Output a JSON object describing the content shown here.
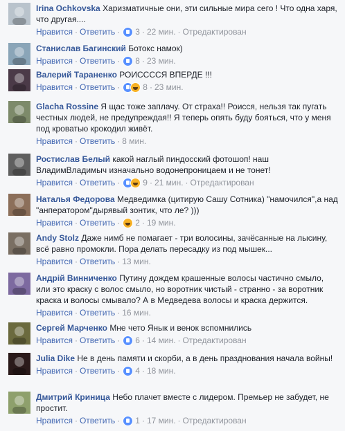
{
  "ui": {
    "like": "Нравится",
    "reply": "Ответить",
    "edited": "Отредактирован",
    "dot": "·"
  },
  "comments": [
    {
      "name": "Irina Ochkovska",
      "text": "Харизматичные они, эти сильные мира сего ! Что одна харя, что другая....",
      "reactions": [
        "like"
      ],
      "count": "3",
      "time": "22 мин.",
      "edited": true,
      "avatar": "#b9c3cc"
    },
    {
      "name": "Станислав Багинский",
      "text": "Ботокс намок)",
      "reactions": [
        "like"
      ],
      "count": "8",
      "time": "23 мин.",
      "edited": false,
      "avatar": "#8aa5b8"
    },
    {
      "name": "Валерий Тараненко",
      "text": "РОИСССCЯ ВПЕРДЕ !!!",
      "reactions": [
        "like",
        "haha"
      ],
      "count": "8",
      "time": "23 мин.",
      "edited": false,
      "avatar": "#4b3a48"
    },
    {
      "name": "Glacha Rossine",
      "text": "Я щас тоже заплачу. От страха!! Роисся, нельзя так пугать честных людей, не предупреждая!! Я теперь опять буду бояться, что у меня под кроватью крокодил живёт.",
      "reactions": [],
      "count": "",
      "time": "8 мин.",
      "edited": false,
      "avatar": "#7d8a6a"
    },
    {
      "name": "Ростислав Белый",
      "text": "какой наглый пиндосский фотошоп! наш ВладимВладимыч изначально водонепроницаем и не тонет!",
      "reactions": [
        "like",
        "haha"
      ],
      "count": "9",
      "time": "21 мин.",
      "edited": true,
      "avatar": "#5f5f5f"
    },
    {
      "name": "Наталья Федорова",
      "text": "Медведимка (цитирую Сашу Сотника) \"намочился\",а над \"анператором\"дырявый зонтик, что ле? )))",
      "reactions": [
        "haha"
      ],
      "count": "2",
      "time": "19 мин.",
      "edited": false,
      "avatar": "#8c6f5a"
    },
    {
      "name": "Andy Stolz",
      "text": "Даже нимб не помагает - три волосины, зачёсанные на лысину, всё равно промокли. Пора делать пересадку из под мышек...",
      "reactions": [],
      "count": "",
      "time": "13 мин.",
      "edited": false,
      "avatar": "#7a6f63"
    },
    {
      "name": "Андрій Винниченко",
      "text": "Путину дождем крашенные волосы частично смыло, или это краску с волос смыло, но воротник чистый - странно - за воротник краска и волосы смывало? А в Медведева волосы и краска держится.",
      "reactions": [],
      "count": "",
      "time": "16 мин.",
      "edited": false,
      "avatar": "#7d6aa0"
    },
    {
      "name": "Сергей Марченко",
      "text": "Мне чето Янык и венок вспомнились",
      "reactions": [
        "like"
      ],
      "count": "6",
      "time": "14 мин.",
      "edited": true,
      "avatar": "#6b6a3e"
    },
    {
      "name": "Julia Dike",
      "text": "Не в день памяти и скорби, а в день празднования начала войны!",
      "reactions": [
        "like"
      ],
      "count": "4",
      "time": "18 мин.",
      "edited": false,
      "avatar": "#2a1a1a"
    },
    {
      "name": "Дмитрий Криница",
      "text": "Небо плачет вместе с лидером. Премьер не забудет, не простит.",
      "reactions": [
        "like"
      ],
      "count": "1",
      "time": "17 мин.",
      "edited": true,
      "avatar": "#8ea06c"
    }
  ]
}
